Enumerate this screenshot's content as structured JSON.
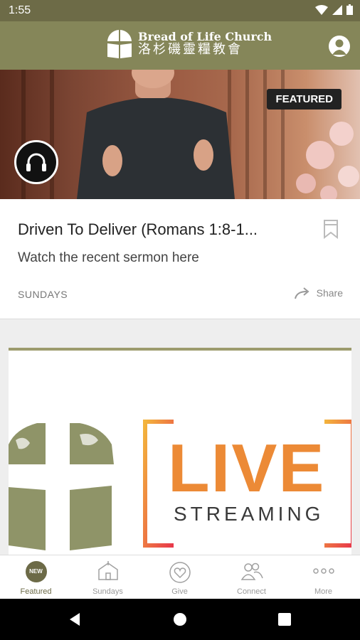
{
  "status_bar": {
    "time": "1:55"
  },
  "header": {
    "church_name_en": "Bread of Life Church",
    "church_name_zh": "洛杉磯靈糧教會"
  },
  "hero": {
    "badge": "FEATURED"
  },
  "featured_card": {
    "title": "Driven To Deliver (Romans 1:8-1...",
    "subtitle": "Watch the recent sermon here",
    "category": "SUNDAYS",
    "share_label": "Share"
  },
  "live_card": {
    "live_text": "LIVE",
    "streaming_text": "STREAMING"
  },
  "bottom_nav": {
    "items": [
      {
        "label": "Featured",
        "icon": "new-badge-icon",
        "badge": "NEW"
      },
      {
        "label": "Sundays",
        "icon": "church-building-icon"
      },
      {
        "label": "Give",
        "icon": "heart-icon"
      },
      {
        "label": "Connect",
        "icon": "people-icon"
      },
      {
        "label": "More",
        "icon": "more-dots-icon"
      }
    ]
  },
  "colors": {
    "header_bg": "#858659",
    "status_bar_bg": "#6d6b47",
    "accent": "#6c6a47",
    "live_gradient_start": "#f3b43c",
    "live_gradient_end": "#e8364a"
  }
}
